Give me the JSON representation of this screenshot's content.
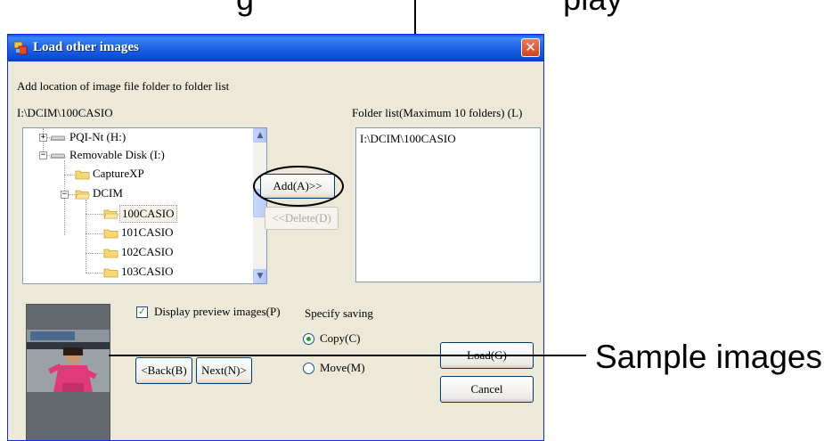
{
  "top_callout": "g                                  play",
  "window": {
    "title": "Load other images",
    "close_glyph": "✕"
  },
  "instruction": "Add location of image file folder to folder list",
  "current_path": "I:\\DCIM\\100CASIO",
  "folder_list_label": "Folder list(Maximum 10 folders) (L)",
  "tree": {
    "items": [
      {
        "label": "PQI-Nt (H:)",
        "icon": "drive-icon",
        "expander": "+"
      },
      {
        "label": "Removable Disk (I:)",
        "icon": "drive-icon",
        "expander": "−"
      },
      {
        "label": "CaptureXP",
        "icon": "folder-icon"
      },
      {
        "label": "DCIM",
        "icon": "folder-icon",
        "expander": "−"
      },
      {
        "label": "100CASIO",
        "icon": "folder-open-icon",
        "selected": true
      },
      {
        "label": "101CASIO",
        "icon": "folder-icon"
      },
      {
        "label": "102CASIO",
        "icon": "folder-icon"
      },
      {
        "label": "103CASIO",
        "icon": "folder-icon"
      }
    ]
  },
  "buttons": {
    "add": "Add(A)>>",
    "delete": "<<Delete(D)",
    "back": "<Back(B)",
    "next": "Next(N)>",
    "load": "Load(G)",
    "cancel": "Cancel"
  },
  "folder_list": [
    "I:\\DCIM\\100CASIO"
  ],
  "preview": {
    "checkbox_label": "Display preview images(P)",
    "checked": true
  },
  "saving": {
    "label": "Specify saving",
    "options": [
      "Copy(C)",
      "Move(M)"
    ],
    "selected": "Copy(C)"
  },
  "annotation": {
    "sample_images": "Sample images"
  },
  "colors": {
    "titlebar": "#0a58e8",
    "dialog_bg": "#ece9d8",
    "close": "#d4431c",
    "checkmark": "#21a121"
  }
}
